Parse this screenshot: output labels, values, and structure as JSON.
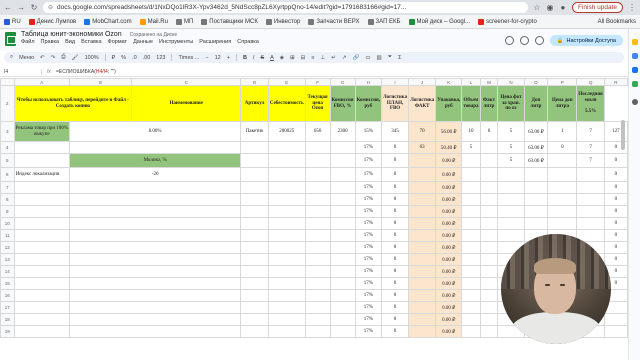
{
  "browser": {
    "url": "docs.google.com/spreadsheets/d/1NxDQo1lR3X-Ypv3462d_5NdScc8pZL6XyrtppQno-14/edit?gid=1791683166#gid=17...",
    "finish_update": "Finish update",
    "bookmarks": [
      {
        "label": "RU",
        "color": "#2a5bd7"
      },
      {
        "label": "Денис Лумпов",
        "color": "#e62117"
      },
      {
        "label": "MobChart.com",
        "color": "#1a73e8"
      },
      {
        "label": "Mail.Ru",
        "color": "#ff9e00"
      },
      {
        "label": "МП",
        "color": "#777777"
      },
      {
        "label": "Поставщики МСК",
        "color": "#777777"
      },
      {
        "label": "Инвестор",
        "color": "#777777"
      },
      {
        "label": "Запчасти ВЕРХ",
        "color": "#777777"
      },
      {
        "label": "ЗАП ЕКБ",
        "color": "#777777"
      },
      {
        "label": "Мой диск – Googl...",
        "color": "#1e8e3e"
      },
      {
        "label": "screener-for-crypto",
        "color": "#e62117"
      }
    ],
    "all_bookmarks": "All Bookmarks"
  },
  "sheet": {
    "title": "Таблица юнит-экономики Ozon",
    "saved_status": "Сохранено на Диске",
    "menu": [
      "Файл",
      "Правка",
      "Вид",
      "Вставка",
      "Формат",
      "Данные",
      "Инструменты",
      "Расширения",
      "Справка"
    ],
    "share_label": "Настройки Доступа",
    "toolbar": {
      "menu_label": "Меню",
      "zoom": "100%",
      "currency": "₽",
      "percent": "%",
      "font": "Times ...",
      "font_size": "12"
    },
    "cell_ref": "I4",
    "formula_prefix": "=ЕСЛИОШИБКА(",
    "formula_ref": "H4/I4",
    "formula_suffix": "; \"\")"
  },
  "grid": {
    "col_letters": [
      "A",
      "B",
      "C",
      "D",
      "E",
      "F",
      "G",
      "H",
      "I",
      "J",
      "K",
      "L",
      "M",
      "N",
      "O",
      "P",
      "Q",
      "R"
    ],
    "headers": {
      "instruction": "Чтобы использовать таблицу, перейдите в Файл - Создать копию",
      "name": "Наименование",
      "article": "Артикул",
      "cost": "Себестоимость",
      "price": "Текущая цена Ozon",
      "commission_pct": "Комиссия FBO, %",
      "commission_rub": "Комиссия, руб",
      "logistics_plan": "Логистика ПЛАН, FBO",
      "logistics_fact": "Логистика ФАКТ",
      "packaging": "Упаковка, руб",
      "volume": "Объем товара",
      "fact_liters": "Факт литр",
      "storage_price": "Цена фот за хран. по оз",
      "liters": "Доп литр",
      "extra_price": "Цена доп литра",
      "last_mile": "Последняя миля",
      "last_mile_pct": "5.5%"
    },
    "rows": [
      {
        "num": "3",
        "a": "Реклама товар при 100% выкупе",
        "b": "8.00%",
        "d": "Пакетик",
        "e": "200025",
        "f": "650",
        "g": "2300",
        "h": "15%",
        "i": "345",
        "j": "70",
        "k": "56.00 ₽",
        "l": "10",
        "m": "6",
        "n": "5",
        "o": "63.00 ₽",
        "p": "1",
        "q": "7",
        "r": "127"
      },
      {
        "num": "4",
        "h": "17%",
        "i": "0",
        "j": "63",
        "k": "50.40 ₽",
        "l": "5",
        "n": "5",
        "o": "63.00 ₽",
        "p": "0",
        "q": "7",
        "r": "0"
      },
      {
        "num": "5",
        "b": "Молоко, %",
        "h": "17%",
        "i": "0",
        "k": "0.00 ₽",
        "n": "5",
        "o": "63.00 ₽",
        "q": "7",
        "r": "0"
      },
      {
        "num": "6",
        "a": "Индекс локализации",
        "b": "-20",
        "h": "17%",
        "i": "0",
        "k": "0.00 ₽",
        "r": "0"
      },
      {
        "num": "7",
        "h": "17%",
        "i": "0",
        "k": "0.00 ₽",
        "r": "0"
      },
      {
        "num": "8",
        "h": "17%",
        "i": "0",
        "k": "0.00 ₽",
        "r": "0"
      },
      {
        "num": "9",
        "h": "17%",
        "i": "0",
        "k": "0.00 ₽",
        "r": "0"
      },
      {
        "num": "10",
        "h": "17%",
        "i": "0",
        "k": "0.00 ₽",
        "r": "0"
      },
      {
        "num": "11",
        "h": "17%",
        "i": "0",
        "k": "0.00 ₽",
        "r": "0"
      },
      {
        "num": "12",
        "h": "17%",
        "i": "0",
        "k": "0.00 ₽",
        "r": "0"
      },
      {
        "num": "13",
        "h": "17%",
        "i": "0",
        "k": "0.00 ₽",
        "r": "0"
      },
      {
        "num": "14",
        "h": "17%",
        "i": "0",
        "k": "0.00 ₽",
        "r": "0"
      },
      {
        "num": "15",
        "h": "17%",
        "i": "0",
        "k": "0.00 ₽",
        "r": "0"
      },
      {
        "num": "16",
        "h": "17%",
        "i": "0",
        "k": "0.00 ₽"
      },
      {
        "num": "17",
        "h": "17%",
        "i": "0",
        "k": "0.00 ₽"
      },
      {
        "num": "18",
        "h": "17%",
        "i": "0",
        "k": "0.00 ₽"
      },
      {
        "num": "19",
        "h": "17%",
        "i": "0",
        "k": "0.00 ₽"
      }
    ]
  }
}
